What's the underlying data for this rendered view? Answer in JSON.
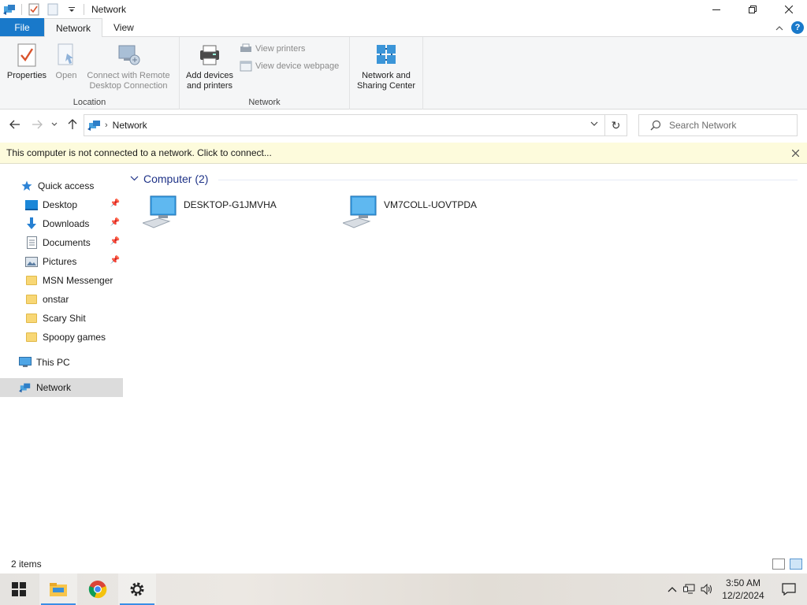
{
  "window": {
    "title": "Network",
    "minimize_icon": "minimize-icon",
    "maximize_icon": "restore-icon",
    "close_icon": "close-icon"
  },
  "ribbon_tabs": {
    "file": "File",
    "network": "Network",
    "view": "View"
  },
  "ribbon": {
    "location_group": "Location",
    "network_group": "Network",
    "properties": "Properties",
    "open": "Open",
    "connect_remote_line1": "Connect with Remote",
    "connect_remote_line2": "Desktop Connection",
    "add_devices_line1": "Add devices",
    "add_devices_line2": "and printers",
    "view_printers": "View printers",
    "view_device_webpage": "View device webpage",
    "network_sharing_line1": "Network and",
    "network_sharing_line2": "Sharing Center"
  },
  "address_bar": {
    "crumb": "Network",
    "search_placeholder": "Search Network"
  },
  "infobar": {
    "message": "This computer is not connected to a network. Click to connect..."
  },
  "nav_pane": {
    "quick_access": "Quick access",
    "items": [
      {
        "label": "Desktop",
        "pinned": true
      },
      {
        "label": "Downloads",
        "pinned": true
      },
      {
        "label": "Documents",
        "pinned": true
      },
      {
        "label": "Pictures",
        "pinned": true
      },
      {
        "label": "MSN Messenger",
        "pinned": false
      },
      {
        "label": "onstar",
        "pinned": false
      },
      {
        "label": "Scary Shit",
        "pinned": false
      },
      {
        "label": "Spoopy games",
        "pinned": false
      }
    ],
    "this_pc": "This PC",
    "network": "Network"
  },
  "content": {
    "group_header": "Computer (2)",
    "computers": [
      {
        "name": "DESKTOP-G1JMVHA"
      },
      {
        "name": "VM7COLL-UOVTPDA"
      }
    ]
  },
  "status_bar": {
    "item_count": "2 items"
  },
  "taskbar": {
    "time": "3:50 AM",
    "date": "12/2/2024"
  },
  "colors": {
    "file_tab": "#1979ca",
    "infobar_bg": "#fdfbdc",
    "group_header": "#1e3287",
    "selected_nav": "#dcdcdc"
  }
}
